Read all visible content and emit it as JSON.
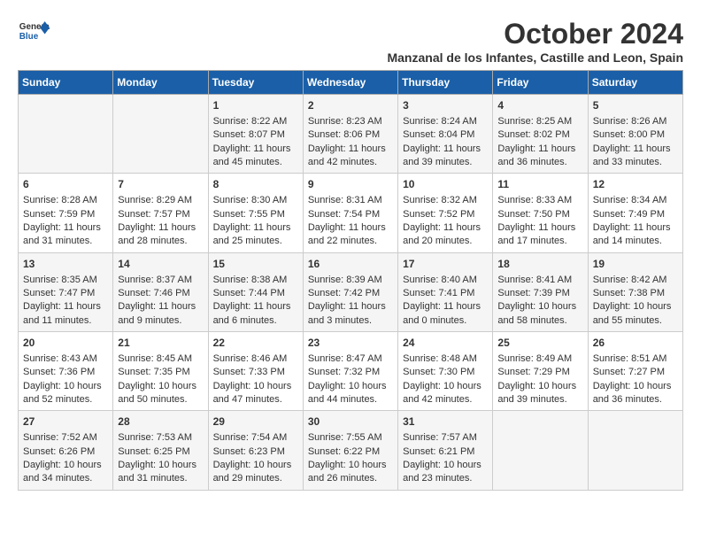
{
  "header": {
    "logo_line1": "General",
    "logo_line2": "Blue",
    "month_title": "October 2024",
    "subtitle": "Manzanal de los Infantes, Castille and Leon, Spain"
  },
  "weekdays": [
    "Sunday",
    "Monday",
    "Tuesday",
    "Wednesday",
    "Thursday",
    "Friday",
    "Saturday"
  ],
  "weeks": [
    [
      {
        "day": "",
        "content": ""
      },
      {
        "day": "",
        "content": ""
      },
      {
        "day": "1",
        "content": "Sunrise: 8:22 AM\nSunset: 8:07 PM\nDaylight: 11 hours and 45 minutes."
      },
      {
        "day": "2",
        "content": "Sunrise: 8:23 AM\nSunset: 8:06 PM\nDaylight: 11 hours and 42 minutes."
      },
      {
        "day": "3",
        "content": "Sunrise: 8:24 AM\nSunset: 8:04 PM\nDaylight: 11 hours and 39 minutes."
      },
      {
        "day": "4",
        "content": "Sunrise: 8:25 AM\nSunset: 8:02 PM\nDaylight: 11 hours and 36 minutes."
      },
      {
        "day": "5",
        "content": "Sunrise: 8:26 AM\nSunset: 8:00 PM\nDaylight: 11 hours and 33 minutes."
      }
    ],
    [
      {
        "day": "6",
        "content": "Sunrise: 8:28 AM\nSunset: 7:59 PM\nDaylight: 11 hours and 31 minutes."
      },
      {
        "day": "7",
        "content": "Sunrise: 8:29 AM\nSunset: 7:57 PM\nDaylight: 11 hours and 28 minutes."
      },
      {
        "day": "8",
        "content": "Sunrise: 8:30 AM\nSunset: 7:55 PM\nDaylight: 11 hours and 25 minutes."
      },
      {
        "day": "9",
        "content": "Sunrise: 8:31 AM\nSunset: 7:54 PM\nDaylight: 11 hours and 22 minutes."
      },
      {
        "day": "10",
        "content": "Sunrise: 8:32 AM\nSunset: 7:52 PM\nDaylight: 11 hours and 20 minutes."
      },
      {
        "day": "11",
        "content": "Sunrise: 8:33 AM\nSunset: 7:50 PM\nDaylight: 11 hours and 17 minutes."
      },
      {
        "day": "12",
        "content": "Sunrise: 8:34 AM\nSunset: 7:49 PM\nDaylight: 11 hours and 14 minutes."
      }
    ],
    [
      {
        "day": "13",
        "content": "Sunrise: 8:35 AM\nSunset: 7:47 PM\nDaylight: 11 hours and 11 minutes."
      },
      {
        "day": "14",
        "content": "Sunrise: 8:37 AM\nSunset: 7:46 PM\nDaylight: 11 hours and 9 minutes."
      },
      {
        "day": "15",
        "content": "Sunrise: 8:38 AM\nSunset: 7:44 PM\nDaylight: 11 hours and 6 minutes."
      },
      {
        "day": "16",
        "content": "Sunrise: 8:39 AM\nSunset: 7:42 PM\nDaylight: 11 hours and 3 minutes."
      },
      {
        "day": "17",
        "content": "Sunrise: 8:40 AM\nSunset: 7:41 PM\nDaylight: 11 hours and 0 minutes."
      },
      {
        "day": "18",
        "content": "Sunrise: 8:41 AM\nSunset: 7:39 PM\nDaylight: 10 hours and 58 minutes."
      },
      {
        "day": "19",
        "content": "Sunrise: 8:42 AM\nSunset: 7:38 PM\nDaylight: 10 hours and 55 minutes."
      }
    ],
    [
      {
        "day": "20",
        "content": "Sunrise: 8:43 AM\nSunset: 7:36 PM\nDaylight: 10 hours and 52 minutes."
      },
      {
        "day": "21",
        "content": "Sunrise: 8:45 AM\nSunset: 7:35 PM\nDaylight: 10 hours and 50 minutes."
      },
      {
        "day": "22",
        "content": "Sunrise: 8:46 AM\nSunset: 7:33 PM\nDaylight: 10 hours and 47 minutes."
      },
      {
        "day": "23",
        "content": "Sunrise: 8:47 AM\nSunset: 7:32 PM\nDaylight: 10 hours and 44 minutes."
      },
      {
        "day": "24",
        "content": "Sunrise: 8:48 AM\nSunset: 7:30 PM\nDaylight: 10 hours and 42 minutes."
      },
      {
        "day": "25",
        "content": "Sunrise: 8:49 AM\nSunset: 7:29 PM\nDaylight: 10 hours and 39 minutes."
      },
      {
        "day": "26",
        "content": "Sunrise: 8:51 AM\nSunset: 7:27 PM\nDaylight: 10 hours and 36 minutes."
      }
    ],
    [
      {
        "day": "27",
        "content": "Sunrise: 7:52 AM\nSunset: 6:26 PM\nDaylight: 10 hours and 34 minutes."
      },
      {
        "day": "28",
        "content": "Sunrise: 7:53 AM\nSunset: 6:25 PM\nDaylight: 10 hours and 31 minutes."
      },
      {
        "day": "29",
        "content": "Sunrise: 7:54 AM\nSunset: 6:23 PM\nDaylight: 10 hours and 29 minutes."
      },
      {
        "day": "30",
        "content": "Sunrise: 7:55 AM\nSunset: 6:22 PM\nDaylight: 10 hours and 26 minutes."
      },
      {
        "day": "31",
        "content": "Sunrise: 7:57 AM\nSunset: 6:21 PM\nDaylight: 10 hours and 23 minutes."
      },
      {
        "day": "",
        "content": ""
      },
      {
        "day": "",
        "content": ""
      }
    ]
  ]
}
